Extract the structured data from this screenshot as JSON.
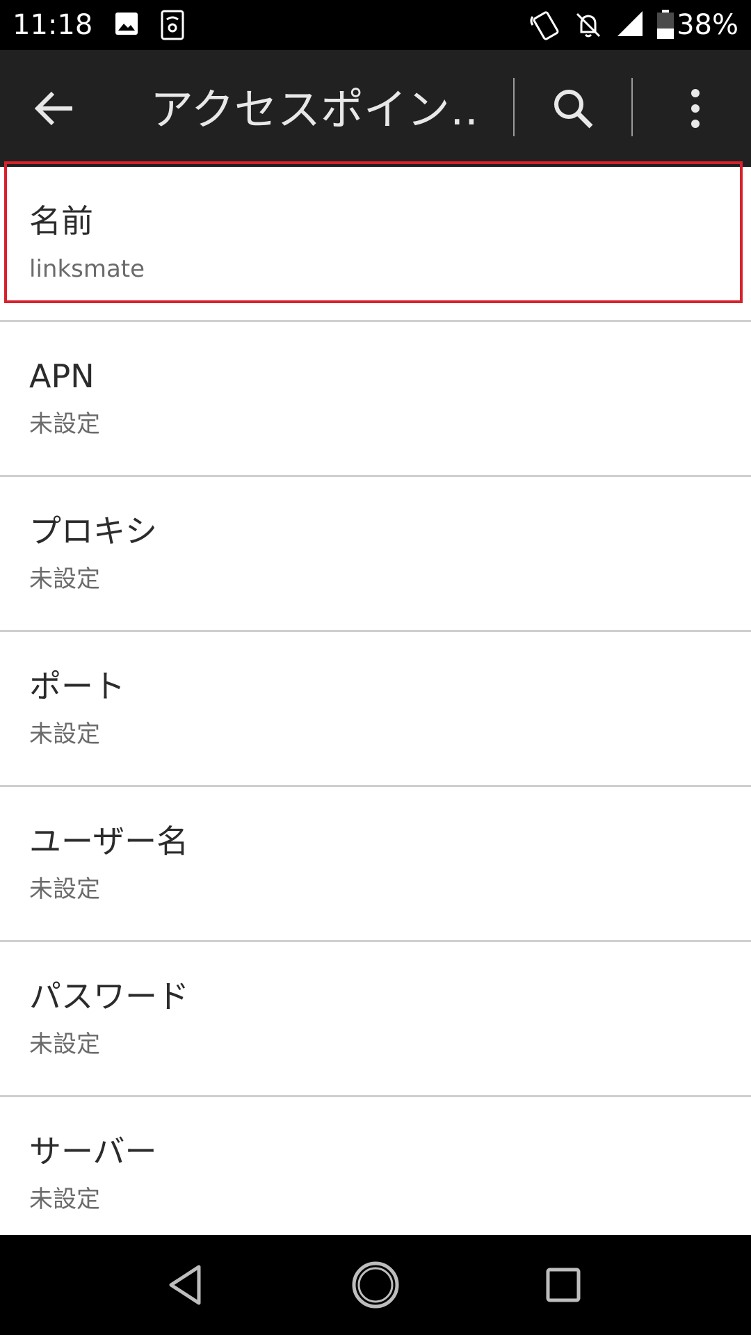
{
  "status_bar": {
    "time": "11:18",
    "battery_percent": "38%",
    "icons": [
      "image-icon",
      "sim-settings-icon",
      "nfc-icon",
      "bell-off-icon",
      "signal-icon",
      "battery-icon"
    ]
  },
  "app_bar": {
    "title": "アクセスポイン…",
    "back_icon": "arrow-left-icon",
    "search_icon": "search-icon",
    "more_icon": "more-vert-icon",
    "background": "#212121"
  },
  "list": {
    "items": [
      {
        "title": "名前",
        "summary": "linksmate"
      },
      {
        "title": "APN",
        "summary": "未設定"
      },
      {
        "title": "プロキシ",
        "summary": "未設定"
      },
      {
        "title": "ポート",
        "summary": "未設定"
      },
      {
        "title": "ユーザー名",
        "summary": "未設定"
      },
      {
        "title": "パスワード",
        "summary": "未設定"
      },
      {
        "title": "サーバー",
        "summary": "未設定"
      }
    ]
  },
  "highlight_color": "#d7222b",
  "nav_bar": {
    "icons": [
      "back-triangle-icon",
      "home-circle-icon",
      "recents-square-icon"
    ]
  }
}
